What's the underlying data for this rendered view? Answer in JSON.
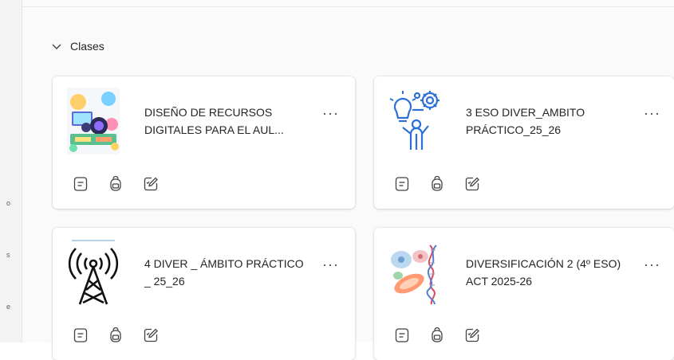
{
  "section": {
    "label": "Clases"
  },
  "classes": [
    {
      "title": "DISEÑO DE RECURSOS DIGITALES PARA EL AUL...",
      "more": "···"
    },
    {
      "title": "3 ESO DIVER_AMBITO PRÁCTICO_25_26",
      "more": "···"
    },
    {
      "title": "4 DIVER _ ÁMBITO PRÁCTICO _ 25_26",
      "more": "···"
    },
    {
      "title": "DIVERSIFICACIÓN 2 (4º ESO) ACT 2025-26",
      "more": "···"
    }
  ],
  "card_actions": [
    "notebook-icon",
    "backpack-icon",
    "assignments-icon"
  ],
  "rail": {
    "marks": [
      "o",
      "s",
      "e"
    ]
  }
}
